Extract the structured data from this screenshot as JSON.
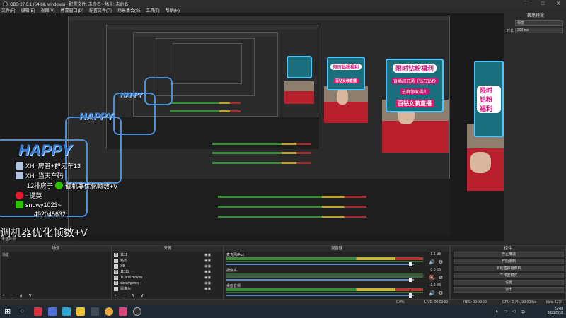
{
  "window": {
    "title": "OBS 27.0.1 (64-bit, windows) - 配置文件: 未命名 - 场景: 未命名",
    "controls": [
      "—",
      "□",
      "✕"
    ]
  },
  "menu": [
    "文件(F)",
    "编辑(E)",
    "视图(V)",
    "停靠窗口(D)",
    "配置文件(P)",
    "场景集合(S)",
    "工具(T)",
    "帮助(H)"
  ],
  "transition": {
    "header": "转场特效",
    "type": "渐变",
    "duration_label": "时长",
    "duration": "300 ms"
  },
  "overlay": {
    "happy": "HAPPY",
    "line1": "XH=房管+群无车13",
    "line2": "XH=当天车码",
    "line3": "12排房子",
    "line3b": "群",
    "line4": "~提莫",
    "line5": "snowy1023~",
    "line6": "492045632",
    "caption": "调机器优化帧数+V"
  },
  "promo": {
    "title": "限时钻粉福利",
    "line1": "直播间开通（钻石钻粉",
    "line2": "进群领取福利",
    "line3": "心愿稀有奖品",
    "big": "百钻女装直播"
  },
  "no_source": "未选择源",
  "docks": {
    "scenes": {
      "header": "场景",
      "item": "场景"
    },
    "sources": {
      "header": "来源",
      "items": [
        {
          "icon": "T",
          "name": "1111"
        },
        {
          "icon": "",
          "name": "钻粉"
        },
        {
          "icon": "",
          "name": "XB"
        },
        {
          "icon": "T",
          "name": "11111"
        },
        {
          "icon": "T",
          "name": "1Cardi moven"
        },
        {
          "icon": "T",
          "name": "sicosygensy"
        },
        {
          "icon": "",
          "name": "摄像头"
        }
      ]
    },
    "mixer": {
      "header": "混音器",
      "channels": [
        {
          "name": "麦克风/Aux",
          "db": "-1.1 dB"
        },
        {
          "name": "摄像头",
          "db": "0.0 dB"
        },
        {
          "name": "桌面音频",
          "db": "-3.2 dB"
        }
      ]
    },
    "controls": {
      "header": "控件",
      "buttons": [
        "停止推流",
        "开始录制",
        "启动虚拟摄像机",
        "工作室模式",
        "设置",
        "退出"
      ]
    },
    "tools_symbols": "+ −  ∧ ∨"
  },
  "status": {
    "live": "LIVE: 00:00:00",
    "rec": "REC: 00:00:00",
    "cpu": "CPU: 2.7%, 30.00 fps",
    "kb": "kb/s: 1270",
    "dropped": "0.0%"
  },
  "taskbar": {
    "time": "22:09",
    "date": "2022/5/18",
    "icons": [
      {
        "name": "windows-icon",
        "color": "#ffffff"
      },
      {
        "name": "search-icon",
        "color": "#cccccc"
      },
      {
        "name": "app-red-icon",
        "color": "#d8323c"
      },
      {
        "name": "app-blue-icon",
        "color": "#4e6fd8"
      },
      {
        "name": "app-teal-icon",
        "color": "#2ea7d6"
      },
      {
        "name": "folder-icon",
        "color": "#f1c232"
      },
      {
        "name": "app-dark-icon",
        "color": "#3f4b5a"
      },
      {
        "name": "chrome-icon",
        "color": "#e8a33c"
      },
      {
        "name": "app-pink-icon",
        "color": "#d9467c"
      },
      {
        "name": "obs-icon",
        "color": "#333333"
      }
    ]
  }
}
